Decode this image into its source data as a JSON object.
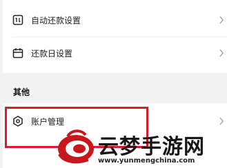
{
  "settings": {
    "items": [
      {
        "label": "自动还款设置",
        "icon": "auto-repay-icon"
      },
      {
        "label": "还款日设置",
        "icon": "calendar-icon"
      }
    ]
  },
  "other": {
    "title": "其他",
    "items": [
      {
        "label": "账户管理",
        "icon": "shield-icon"
      }
    ]
  },
  "watermark": {
    "title": "云梦手游网",
    "url": "www.yunmengchina.com"
  },
  "colors": {
    "highlight": "#e0182a",
    "background": "#f2f2f2"
  }
}
